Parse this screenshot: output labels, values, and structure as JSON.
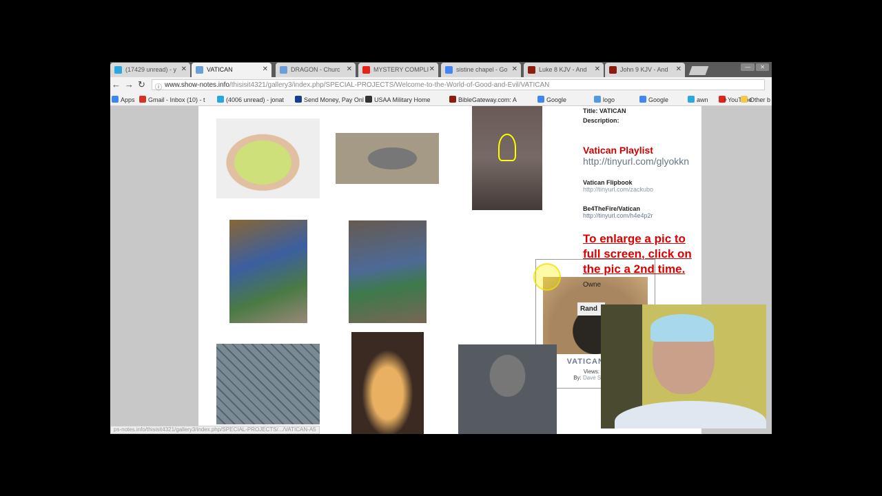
{
  "browser": {
    "tabs": [
      {
        "label": "(17429 unread) - y",
        "icon": "circle-icon",
        "color": "#2aa6e0"
      },
      {
        "label": "VATICAN",
        "icon": "gallery-icon",
        "color": "#6a9fd8",
        "active": true
      },
      {
        "label": "DRAGON - Churc",
        "icon": "gallery-icon",
        "color": "#6a9fd8"
      },
      {
        "label": "MYSTERY COMPLI",
        "icon": "youtube-icon",
        "color": "#e62117"
      },
      {
        "label": "sistine chapel - Go",
        "icon": "google-icon",
        "color": "#4285f4"
      },
      {
        "label": "Luke 8 KJV - And",
        "icon": "biblegateway-icon",
        "color": "#8b1d10"
      },
      {
        "label": "John 9 KJV - And",
        "icon": "biblegateway-icon",
        "color": "#8b1d10"
      }
    ],
    "url_domain": "www.show-notes.info",
    "url_path": "/thisisit4321/gallery3/index.php/SPECIAL-PROJECTS/Welcome-to-the-World-of-Good-and-Evil/VATICAN",
    "bookmarks": [
      "Apps",
      "Gmail - Inbox (10) - t",
      "(4006 unread) - jonat",
      "Send Money, Pay Onl",
      "USAA Military Home",
      "BibleGateway.com: A",
      "Google",
      "logo",
      "Google",
      "awn",
      "YouTube",
      "»",
      "Other b"
    ],
    "status_url": "ps-notes.info/thisisit4321/gallery3/index.php/SPECIAL-PROJECTS/.../VATICAN-A5"
  },
  "gallery": {
    "hover_item": {
      "title": "VATICAN - A5",
      "views": "Views: 50",
      "by_label": "By:",
      "by": "Dave Shadow"
    }
  },
  "sidebar": {
    "title": "Title: VATICAN",
    "description": "Description:",
    "playlist_heading": "Vatican Playlist",
    "playlist_url": "http://tinyurl.com/glyokkn",
    "flipbook_label": "Vatican Flipbook",
    "flipbook_url": "http://tinyurl.com/zackubo",
    "fire_label": "Be4TheFire/Vatican",
    "fire_url": "http://tinyurl.com/h4e4p2r",
    "enlarge_note": "To enlarge a pic to full screen, click on the pic a 2nd time.",
    "owner": "Owne",
    "random": "Rand"
  }
}
